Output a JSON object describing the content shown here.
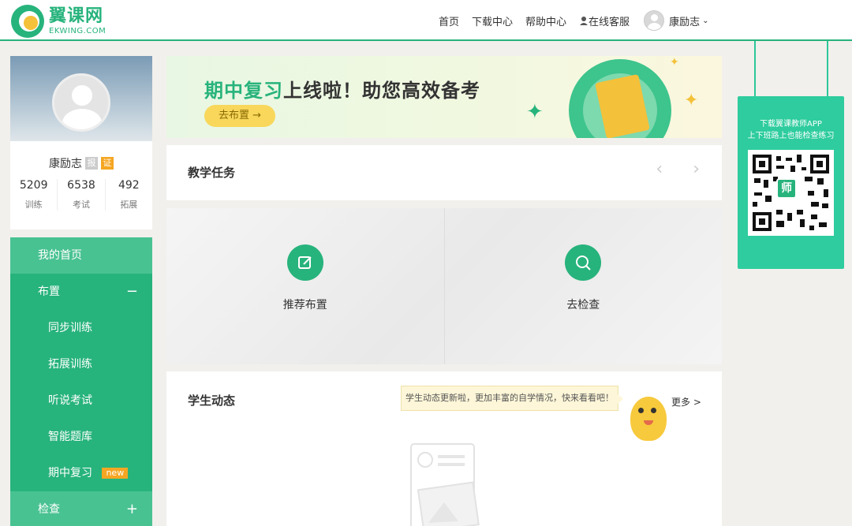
{
  "header": {
    "logo_cn": "翼课网",
    "logo_en": "EKWING.COM",
    "nav": [
      "首页",
      "下载中心",
      "帮助中心"
    ],
    "service": "在线客服",
    "username": "康励志"
  },
  "profile": {
    "name": "康励志",
    "tag1": "报",
    "tag2": "证",
    "stats": [
      {
        "value": "5209",
        "label": "训练"
      },
      {
        "value": "6538",
        "label": "考试"
      },
      {
        "value": "492",
        "label": "拓展"
      }
    ]
  },
  "menu": {
    "home": "我的首页",
    "assign": "布置",
    "assign_toggle": "−",
    "sub": [
      "同步训练",
      "拓展训练",
      "听说考试",
      "智能题库"
    ],
    "midterm": "期中复习",
    "new_badge": "new",
    "check": "检查",
    "check_toggle": "+"
  },
  "banner": {
    "title_hl": "期中复习",
    "title_rest": "上线啦！助您高效备考",
    "button": "去布置 →"
  },
  "task": {
    "title": "教学任务",
    "prev": "‹",
    "next": "›"
  },
  "actions": {
    "recommend": "推荐布置",
    "check": "去检查"
  },
  "activity": {
    "title": "学生动态",
    "tooltip": "学生动态更新啦，更加丰富的自学情况，快来看看吧！",
    "more": "更多 >"
  },
  "qr": {
    "line1": "下载翼课教师APP",
    "line2": "上下班路上也能检查练习",
    "center": "师"
  },
  "colors": {
    "brand": "#27b37c",
    "menu_active": "#49c292",
    "qr_panel": "#2ecc9e",
    "badge": "#f5a623"
  }
}
